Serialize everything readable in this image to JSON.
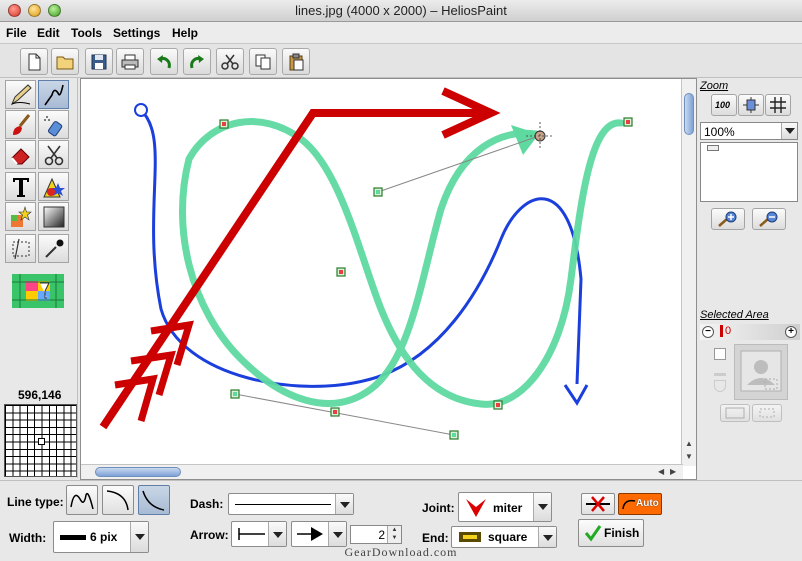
{
  "window": {
    "title": "lines.jpg (4000 x 2000) – HeliosPaint"
  },
  "menu": {
    "items": [
      "File",
      "Edit",
      "Tools",
      "Settings",
      "Help"
    ]
  },
  "toolbar": {
    "buttons": [
      {
        "name": "new-icon"
      },
      {
        "name": "open-folder-icon"
      },
      {
        "name": "save-disk-icon"
      },
      {
        "name": "print-icon"
      },
      {
        "name": "undo-icon"
      },
      {
        "name": "redo-icon"
      },
      {
        "name": "cut-scissors-icon"
      },
      {
        "name": "copy-icon"
      },
      {
        "name": "paste-icon"
      }
    ]
  },
  "toolbox": {
    "tools": [
      "pencil",
      "curve-line",
      "brush",
      "spray",
      "eraser",
      "magic-scissors",
      "text",
      "shapes",
      "effects",
      "gradient",
      "selection",
      "eyedropper"
    ],
    "active_tool": "curve-line",
    "color_widget": "color-picker"
  },
  "navigator": {
    "coordinates": "596,146"
  },
  "right_panel": {
    "zoom_label": "Zoom",
    "zoom_value": "100%",
    "zoom_100_label": "100",
    "selected_area_label": "Selected Area",
    "selected_area_value": "0"
  },
  "bottom": {
    "line_type_label": "Line type:",
    "width_label": "Width:",
    "width_value": "6 pix",
    "dash_label": "Dash:",
    "arrow_label": "Arrow:",
    "arrow_size": "2",
    "joint_label": "Joint:",
    "joint_value": "miter",
    "end_label": "End:",
    "end_value": "square",
    "auto_label": "Auto",
    "finish_label": "Finish"
  },
  "colors": {
    "red_arrow": "#cc0000",
    "green_curve": "#5ed9a0",
    "blue_curve": "#1a3fdc",
    "accent": "#6a92cf"
  },
  "watermark": "GearDownload.com"
}
